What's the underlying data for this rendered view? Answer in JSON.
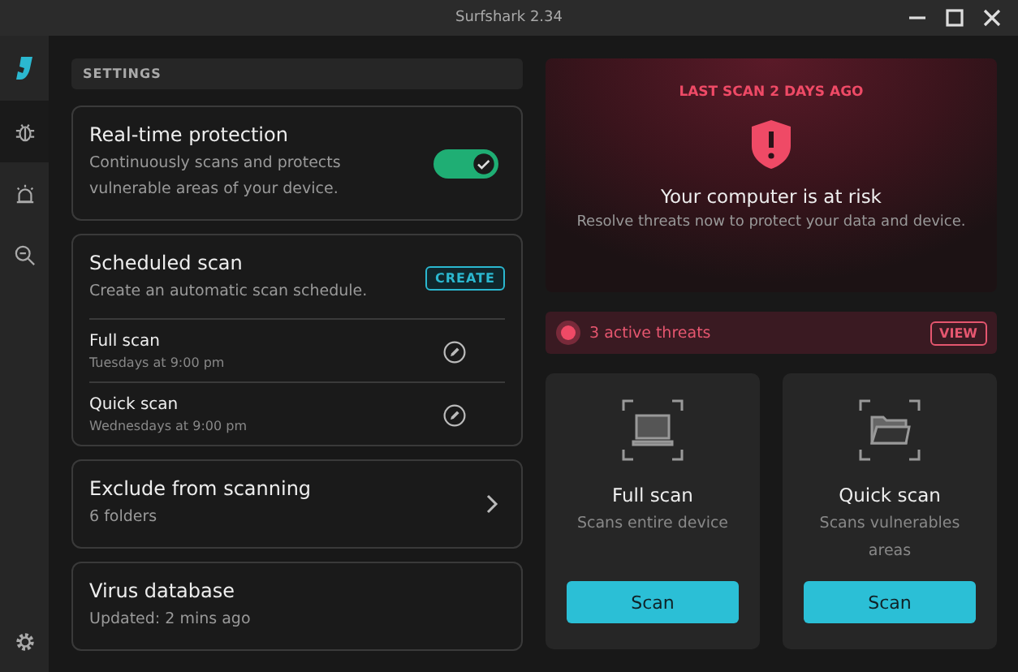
{
  "window": {
    "title": "Surfshark 2.34"
  },
  "sidebar": {
    "items": [
      {
        "kind": "bug",
        "selected": true
      },
      {
        "kind": "alarm",
        "selected": false
      },
      {
        "kind": "zoom",
        "selected": false
      }
    ]
  },
  "settings": {
    "header": "SETTINGS",
    "realtime": {
      "title": "Real-time protection",
      "description": "Continuously scans and protects vulnerable areas of your device.",
      "on": true
    },
    "scheduled": {
      "title": "Scheduled scan",
      "description": "Create an automatic scan schedule.",
      "button": "CREATE",
      "items": [
        {
          "name": "Full scan",
          "when": "Tuesdays at 9:00 pm"
        },
        {
          "name": "Quick scan",
          "when": "Wednesdays at 9:00 pm"
        }
      ]
    },
    "exclude": {
      "title": "Exclude from scanning",
      "detail": "6 folders"
    },
    "database": {
      "title": "Virus database",
      "detail": "Updated: 2 mins ago"
    }
  },
  "status": {
    "last_scan": "LAST SCAN 2 DAYS AGO",
    "title": "Your computer is at risk",
    "description": "Resolve threats now to protect your data and device."
  },
  "threats": {
    "label": "3 active threats",
    "button": "VIEW"
  },
  "scans": [
    {
      "kind": "laptop",
      "title": "Full scan",
      "description": "Scans entire device",
      "button": "Scan"
    },
    {
      "kind": "folder",
      "title": "Quick scan",
      "description": "Scans vulnerables areas",
      "button": "Scan"
    }
  ]
}
